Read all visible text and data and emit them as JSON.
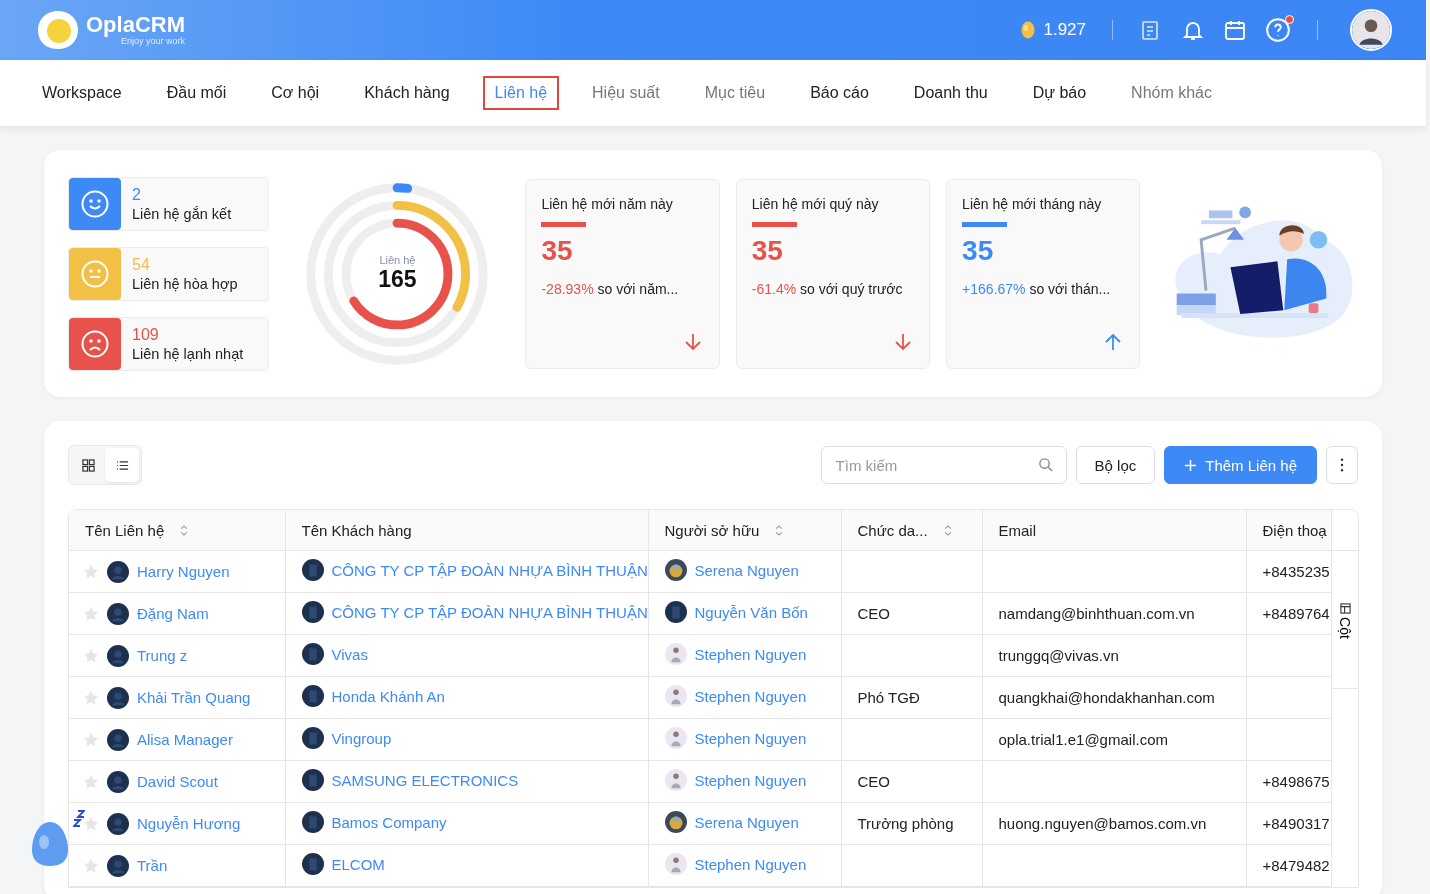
{
  "header": {
    "logo": "OplaCRM",
    "tagline": "Enjoy your work",
    "coins": "1.927",
    "help_badge": true
  },
  "nav": [
    {
      "label": "Workspace",
      "selected": false,
      "muted": false
    },
    {
      "label": "Đầu mối",
      "selected": false,
      "muted": false
    },
    {
      "label": "Cơ hội",
      "selected": false,
      "muted": false
    },
    {
      "label": "Khách hàng",
      "selected": false,
      "muted": false
    },
    {
      "label": "Liên hệ",
      "selected": true,
      "muted": false
    },
    {
      "label": "Hiệu suất",
      "selected": false,
      "muted": true
    },
    {
      "label": "Mục tiêu",
      "selected": false,
      "muted": true
    },
    {
      "label": "Báo cáo",
      "selected": false,
      "muted": false
    },
    {
      "label": "Doanh thu",
      "selected": false,
      "muted": false
    },
    {
      "label": "Dự báo",
      "selected": false,
      "muted": false
    },
    {
      "label": "Nhóm khác",
      "selected": false,
      "muted": true
    }
  ],
  "segments": [
    {
      "kind": "happy",
      "count": "2",
      "label": "Liên hệ gắn kết",
      "color": "#3d8af7"
    },
    {
      "kind": "neutral",
      "count": "54",
      "label": "Liên hệ hòa hợp",
      "color": "#f2c044"
    },
    {
      "kind": "sad",
      "count": "109",
      "label": "Liên hệ lạnh nhạt",
      "color": "#e8524a"
    }
  ],
  "rings": [
    {
      "color": "#3d8af7",
      "level": 0.02
    },
    {
      "color": "#f2c044",
      "level": 0.33
    },
    {
      "color": "#e8524a",
      "level": 0.66
    }
  ],
  "total": {
    "label": "Liên hệ",
    "value": "165"
  },
  "trends": [
    {
      "title": "Liên hệ mới năm này",
      "value": "35",
      "change": "-28.93%",
      "compare": "so với năm...",
      "rising": false
    },
    {
      "title": "Liên hệ mới quý này",
      "value": "35",
      "change": "-61.4%",
      "compare": "so với quý trước",
      "rising": false
    },
    {
      "title": "Liên hệ mới tháng này",
      "value": "35",
      "change": "+166.67%",
      "compare": "so với thán...",
      "rising": true
    }
  ],
  "view_toggle": [
    {
      "kind": "grid",
      "selected": false
    },
    {
      "kind": "list",
      "selected": true
    }
  ],
  "search": {
    "placeholder": "Tìm kiếm"
  },
  "filter_button": "Bộ lọc",
  "add_button": "Thêm Liên hệ",
  "table": {
    "columns": [
      {
        "label": "Tên Liên hệ",
        "sortable": true
      },
      {
        "label": "Tên Khách hàng",
        "sortable": false
      },
      {
        "label": "Người sở hữu",
        "sortable": true
      },
      {
        "label": "Chức da...",
        "sortable": true
      },
      {
        "label": "Email",
        "sortable": false
      },
      {
        "label": "Điện thoạ",
        "sortable": false
      }
    ],
    "side_label": "Cột",
    "rows": [
      {
        "starred": false,
        "snoozed": false,
        "name": "Harry Nguyen",
        "customer": "CÔNG TY CP TẬP ĐOÀN NHỰA BÌNH THUẬN",
        "owner": {
          "kind": "photo",
          "name": "Serena Nguyen"
        },
        "position": "",
        "email": "",
        "phone": "+8435235"
      },
      {
        "starred": false,
        "snoozed": false,
        "name": "Đặng Nam",
        "customer": "CÔNG TY CP TẬP ĐOÀN NHỰA BÌNH THUẬN",
        "owner": {
          "kind": "default",
          "name": "Nguyễn Văn Bốn"
        },
        "position": "CEO",
        "email": "namdang@binhthuan.com.vn",
        "phone": "+8489764"
      },
      {
        "starred": false,
        "snoozed": false,
        "name": "Trung z",
        "customer": "Vivas",
        "owner": {
          "kind": "person",
          "name": "Stephen Nguyen"
        },
        "position": "",
        "email": "trunggq@vivas.vn",
        "phone": ""
      },
      {
        "starred": false,
        "snoozed": false,
        "name": "Khải Trần Quang",
        "customer": "Honda Khánh An",
        "owner": {
          "kind": "person",
          "name": "Stephen Nguyen"
        },
        "position": "Phó TGĐ",
        "email": "quangkhai@hondakhanhan.com",
        "phone": ""
      },
      {
        "starred": false,
        "snoozed": false,
        "name": "Alisa Manager",
        "customer": "Vingroup",
        "owner": {
          "kind": "person",
          "name": "Stephen Nguyen"
        },
        "position": "",
        "email": "opla.trial1.e1@gmail.com",
        "phone": ""
      },
      {
        "starred": false,
        "snoozed": false,
        "name": "David Scout",
        "customer": "SAMSUNG ELECTRONICS",
        "owner": {
          "kind": "person",
          "name": "Stephen Nguyen"
        },
        "position": "CEO",
        "email": "",
        "phone": "+8498675"
      },
      {
        "starred": false,
        "snoozed": true,
        "name": "Nguyễn Hương",
        "customer": "Bamos Company",
        "owner": {
          "kind": "photo",
          "name": "Serena Nguyen"
        },
        "position": "Trưởng phòng",
        "email": "huong.nguyen@bamos.com.vn",
        "phone": "+8490317"
      },
      {
        "starred": false,
        "snoozed": false,
        "name": "Trần",
        "customer": "ELCOM",
        "owner": {
          "kind": "person",
          "name": "Stephen Nguyen"
        },
        "position": "",
        "email": "",
        "phone": "+8479482"
      }
    ]
  }
}
